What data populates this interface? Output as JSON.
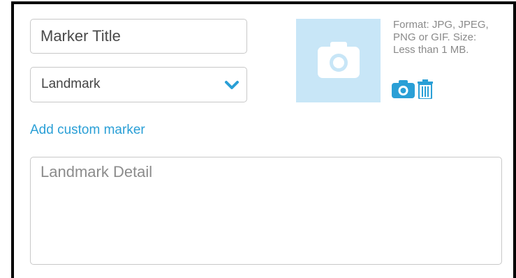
{
  "form": {
    "title_placeholder": "Marker Title",
    "type_select": {
      "selected": "Landmark"
    },
    "add_custom_marker_label": "Add custom marker",
    "detail_placeholder": "Landmark Detail"
  },
  "photo": {
    "format_hint": "Format: JPG, JPEG, PNG or GIF. Size: Less than 1 MB.",
    "placeholder_icon": "camera-icon",
    "upload_icon": "camera-icon",
    "delete_icon": "trash-icon"
  },
  "colors": {
    "accent": "#2a9fd6",
    "photo_placeholder_bg": "#c8e6f7",
    "border": "#c8c8c8",
    "text": "#444444",
    "hint_text": "#8a8a8a"
  }
}
